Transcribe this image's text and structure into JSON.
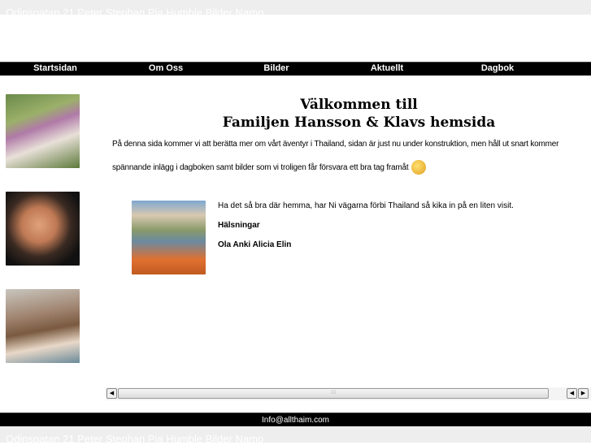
{
  "header": {
    "hidden_text": "Odinsgatan 21 Peter Stephan Pia Humble Bilder Namo"
  },
  "nav": {
    "items": [
      "Startsidan",
      "Om Oss",
      "Bilder",
      "Aktuellt",
      "Dagbok"
    ]
  },
  "main": {
    "title_line1": "Välkommen till",
    "title_line2": "Familjen Hansson & Klavs hemsida",
    "intro_line1": "På denna sida kommer vi att berätta mer om vårt äventyr i Thailand, sidan är just nu under konstruktion, men håll ut snart kommer",
    "intro_line2": "spännande inlägg i dagboken samt bilder som vi troligen får försvara ett bra tag framåt",
    "message": "Ha det så bra där hemma, har Ni vägarna förbi Thailand så kika in på en liten visit.",
    "greeting": "Hälsningar",
    "signature": "Ola Anki Alicia Elin"
  },
  "footer": {
    "email": "Info@allthaim.com",
    "hidden_text": "Odinsgatan 21 Peter Stephan Pia Humble Bilder Namo"
  }
}
